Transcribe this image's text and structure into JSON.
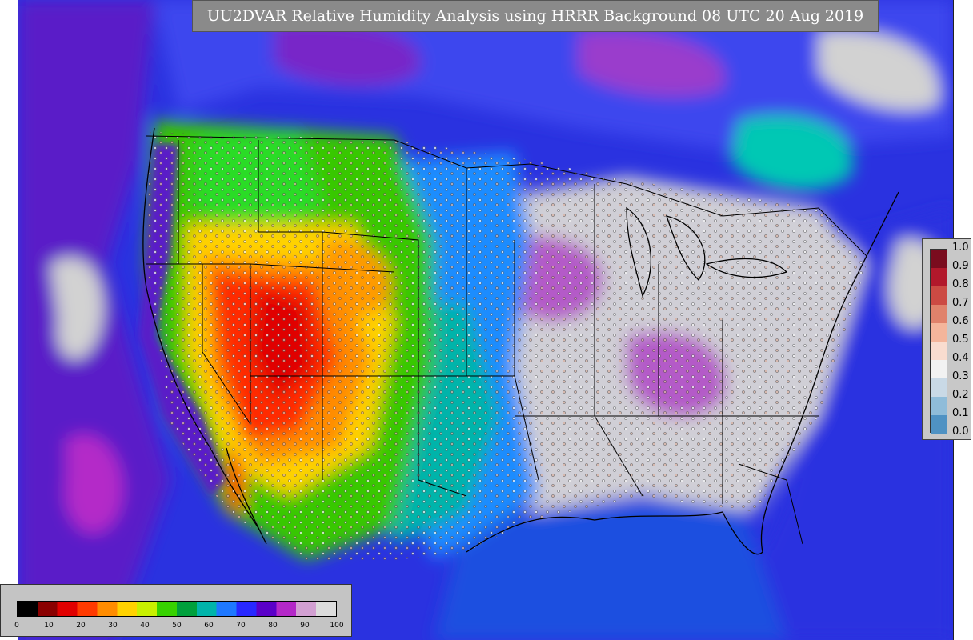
{
  "title": "UU2DVAR Relative Humidity Analysis using HRRR Background 08 UTC 20 Aug 2019",
  "increment_legend": {
    "ticks": [
      "1.0",
      "0.9",
      "0.8",
      "0.7",
      "0.6",
      "0.5",
      "0.4",
      "0.3",
      "0.2",
      "0.1",
      "0.0"
    ],
    "colors": [
      "#7a0c1e",
      "#b2182b",
      "#cc4a43",
      "#e0826b",
      "#f4b59b",
      "#f9dccf",
      "#f2f2f2",
      "#c9d9e6",
      "#8fbcd9",
      "#4f92c3",
      "#2166ac"
    ]
  },
  "rh_colorbar": {
    "ticks": [
      "0",
      "10",
      "20",
      "30",
      "40",
      "50",
      "60",
      "70",
      "80",
      "90",
      "100"
    ],
    "colors": [
      "#000000",
      "#8a0000",
      "#e00000",
      "#ff3a00",
      "#ff8c00",
      "#ffd200",
      "#c8f000",
      "#37d200",
      "#00a03c",
      "#00b4aa",
      "#1e78ff",
      "#2828ff",
      "#5a00c8",
      "#b428c8",
      "#d2a0d2",
      "#dcdcdc"
    ]
  },
  "colors": {
    "ocean_humid": "#2a32e0",
    "ocean_moist": "#7a1ec8",
    "saturated": "#d2d2d2",
    "dry_core": "#ff2a00",
    "moderate": "#37c800",
    "boundary": "#000000"
  }
}
